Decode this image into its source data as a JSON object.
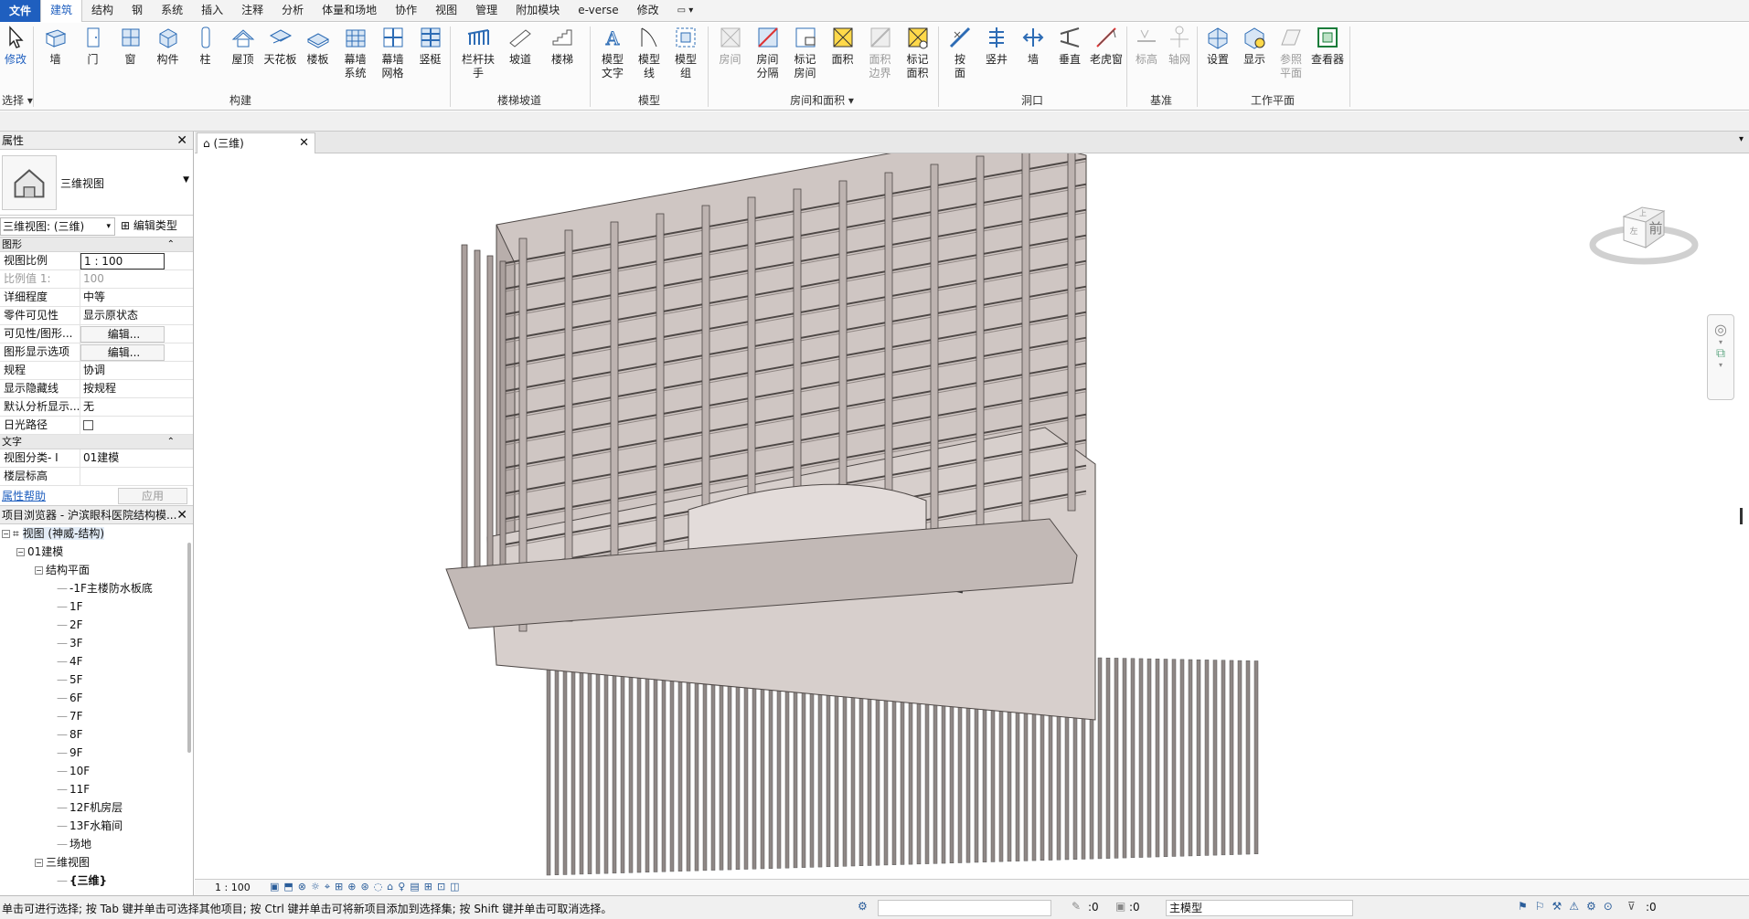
{
  "menu": {
    "file": "文件",
    "tabs": [
      "建筑",
      "结构",
      "钢",
      "系统",
      "插入",
      "注释",
      "分析",
      "体量和场地",
      "协作",
      "视图",
      "管理",
      "附加模块",
      "e-verse",
      "修改"
    ],
    "active_index": 0
  },
  "ribbon": {
    "modify": "修改",
    "select": "选择",
    "build": [
      {
        "id": "wall",
        "label": "墙",
        "icon": "wall-icon"
      },
      {
        "id": "door",
        "label": "门",
        "icon": "door-icon"
      },
      {
        "id": "window",
        "label": "窗",
        "icon": "window-icon"
      },
      {
        "id": "component",
        "label": "构件",
        "icon": "component-icon"
      },
      {
        "id": "column",
        "label": "柱",
        "icon": "column-icon"
      },
      {
        "id": "roof",
        "label": "屋顶",
        "icon": "roof-icon"
      },
      {
        "id": "ceiling",
        "label": "天花板",
        "icon": "ceiling-icon"
      },
      {
        "id": "floor",
        "label": "楼板",
        "icon": "floor-icon"
      },
      {
        "id": "curtain-system",
        "label": "幕墙\n系统",
        "icon": "curtain-system-icon"
      },
      {
        "id": "curtain-grid",
        "label": "幕墙\n网格",
        "icon": "curtain-grid-icon"
      },
      {
        "id": "mullion",
        "label": "竖梃",
        "icon": "mullion-icon"
      }
    ],
    "build_panel": "构建",
    "circulation": [
      {
        "id": "railing",
        "label": "栏杆扶手",
        "icon": "railing-icon"
      },
      {
        "id": "ramp",
        "label": "坡道",
        "icon": "ramp-icon"
      },
      {
        "id": "stair",
        "label": "楼梯",
        "icon": "stair-icon"
      }
    ],
    "circulation_panel": "楼梯坡道",
    "model": [
      {
        "id": "model-text",
        "label": "模型\n文字",
        "icon": "model-text-icon"
      },
      {
        "id": "model-line",
        "label": "模型\n线",
        "icon": "model-line-icon"
      },
      {
        "id": "model-group",
        "label": "模型\n组",
        "icon": "model-group-icon"
      }
    ],
    "model_panel": "模型",
    "room": [
      {
        "id": "room",
        "label": "房间",
        "icon": "room-icon",
        "dim": true
      },
      {
        "id": "room-separator",
        "label": "房间\n分隔",
        "icon": "room-separator-icon"
      },
      {
        "id": "tag-room",
        "label": "标记\n房间",
        "icon": "tag-room-icon"
      },
      {
        "id": "area",
        "label": "面积",
        "icon": "area-icon"
      },
      {
        "id": "area-boundary",
        "label": "面积\n边界",
        "icon": "area-boundary-icon",
        "dim": true
      },
      {
        "id": "tag-area",
        "label": "标记\n面积",
        "icon": "tag-area-icon"
      }
    ],
    "room_panel": "房间和面积",
    "opening": [
      {
        "id": "by-face",
        "label": "按\n面",
        "icon": "by-face-icon"
      },
      {
        "id": "shaft",
        "label": "竖井",
        "icon": "shaft-icon"
      },
      {
        "id": "wall-opening",
        "label": "墙",
        "icon": "wall-opening-icon"
      },
      {
        "id": "vertical",
        "label": "垂直",
        "icon": "vertical-opening-icon"
      },
      {
        "id": "dormer",
        "label": "老虎窗",
        "icon": "dormer-icon"
      }
    ],
    "opening_panel": "洞口",
    "datum": [
      {
        "id": "level",
        "label": "标高",
        "icon": "level-icon",
        "dim": true
      },
      {
        "id": "grid",
        "label": "轴网",
        "icon": "grid-icon",
        "dim": true
      }
    ],
    "datum_panel": "基准",
    "workplane": [
      {
        "id": "set",
        "label": "设置",
        "icon": "set-workplane-icon"
      },
      {
        "id": "show",
        "label": "显示",
        "icon": "show-workplane-icon"
      },
      {
        "id": "ref-plane",
        "label": "参照\n平面",
        "icon": "ref-plane-icon",
        "dim": true
      },
      {
        "id": "viewer",
        "label": "查看器",
        "icon": "viewer-icon"
      }
    ],
    "workplane_panel": "工作平面"
  },
  "properties": {
    "title": "属性",
    "type_name": "三维视图",
    "view_selector": "三维视图: (三维)",
    "edit_type": "编辑类型",
    "group_graphics": "图形",
    "rows": [
      {
        "k": "视图比例",
        "v": "1 : 100",
        "style": "box"
      },
      {
        "k": "比例值 1:",
        "v": "100",
        "style": "gray"
      },
      {
        "k": "详细程度",
        "v": "中等",
        "style": ""
      },
      {
        "k": "零件可见性",
        "v": "显示原状态",
        "style": ""
      },
      {
        "k": "可见性/图形...",
        "v": "编辑...",
        "style": "btn"
      },
      {
        "k": "图形显示选项",
        "v": "编辑...",
        "style": "btn"
      },
      {
        "k": "规程",
        "v": "协调",
        "style": ""
      },
      {
        "k": "显示隐藏线",
        "v": "按规程",
        "style": ""
      },
      {
        "k": "默认分析显示...",
        "v": "无",
        "style": ""
      },
      {
        "k": "日光路径",
        "v": "",
        "style": "check"
      }
    ],
    "group_text": "文字",
    "text_rows": [
      {
        "k": "视图分类- I",
        "v": "01建模"
      },
      {
        "k": "楼层标高",
        "v": ""
      }
    ],
    "help": "属性帮助",
    "apply": "应用"
  },
  "browser": {
    "title": "项目浏览器 - 沪滨眼科医院结构模...",
    "root": "视图 (神威-结构)",
    "group": "01建模",
    "plans": "结构平面",
    "levels": [
      "-1F主楼防水板底",
      "1F",
      "2F",
      "3F",
      "4F",
      "5F",
      "6F",
      "7F",
      "8F",
      "9F",
      "10F",
      "11F",
      "12F机房层",
      "13F水箱间",
      "场地"
    ],
    "views3d": "三维视图",
    "current3d": "{三维}"
  },
  "view": {
    "tab": "(三维)",
    "scale": "1 : 100",
    "viewcube_face": "前",
    "viewcube_top": "上",
    "viewcube_left": "左"
  },
  "status": {
    "message": "单击可进行选择; 按 Tab 键并单击可选择其他项目; 按 Ctrl 键并单击可将新项目添加到选择集; 按 Shift 键并单击可取消选择。",
    "count": ":0",
    "count2": ":0",
    "model": "主模型",
    "filter": ":0"
  },
  "colors": {
    "accent": "#1f5fbf",
    "concrete": "#cfc6c3",
    "edge": "#4e4846"
  }
}
